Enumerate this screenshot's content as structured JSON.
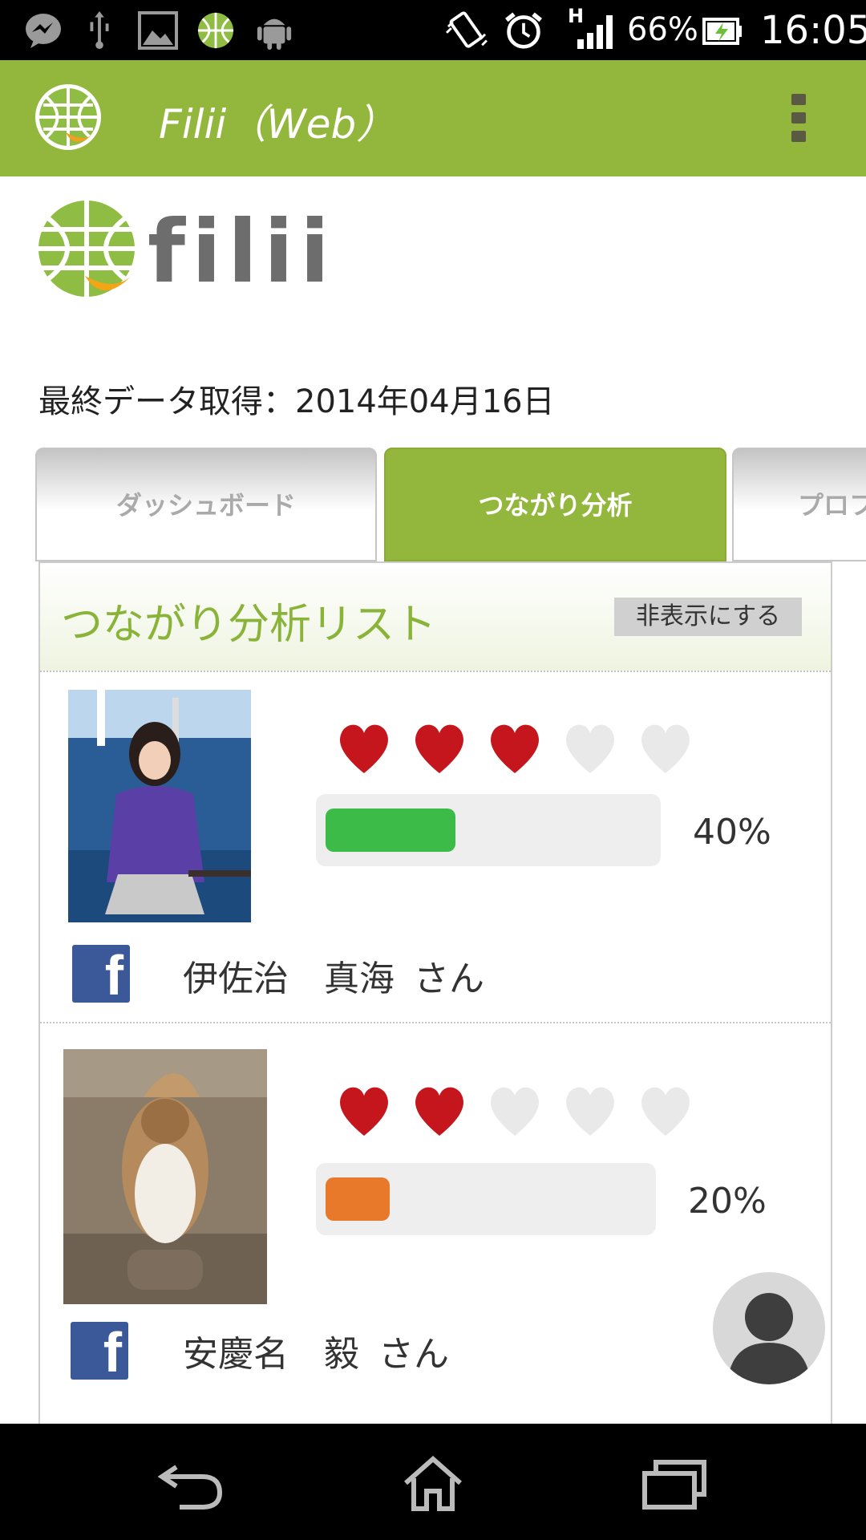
{
  "status_bar": {
    "battery": "66%",
    "clock": "16:05",
    "network_type": "H",
    "icons": [
      "messenger-icon",
      "usb-icon",
      "gallery-icon",
      "filii-icon",
      "android-debug-icon",
      "vibrate-icon",
      "alarm-icon",
      "signal-icon",
      "battery-charging-icon"
    ]
  },
  "action_bar": {
    "title": "Filii（Web）",
    "app_icon": "filii-globe-icon",
    "menu_icon": "overflow-menu-icon"
  },
  "header": {
    "logo_text": "filii",
    "last_fetch": "最終データ取得：2014年04月16日"
  },
  "tabs": [
    {
      "label": "ダッシュボード",
      "active": false
    },
    {
      "label": "つながり分析",
      "active": true
    },
    {
      "label": "プロフ",
      "active": false
    }
  ],
  "panel": {
    "title": "つながり分析リスト",
    "hide_button": "非表示にする"
  },
  "entries": [
    {
      "name": "伊佐治　真海",
      "suffix": "さん",
      "hearts_filled": 3,
      "hearts_total": 5,
      "percent_label": "40%",
      "progress": 0.4,
      "bar_color": "#3dbb48",
      "source": "facebook"
    },
    {
      "name": "安慶名　毅",
      "suffix": "さん",
      "hearts_filled": 2,
      "hearts_total": 5,
      "percent_label": "20%",
      "progress": 0.2,
      "bar_color": "#e8792a",
      "source": "facebook"
    }
  ],
  "colors": {
    "accent_green": "#93b73d",
    "heart_filled": "#c4161c",
    "heart_empty": "#e9e9e9",
    "facebook_blue": "#3b5998"
  },
  "nav_bar": [
    "back-icon",
    "home-icon",
    "recent-apps-icon"
  ]
}
